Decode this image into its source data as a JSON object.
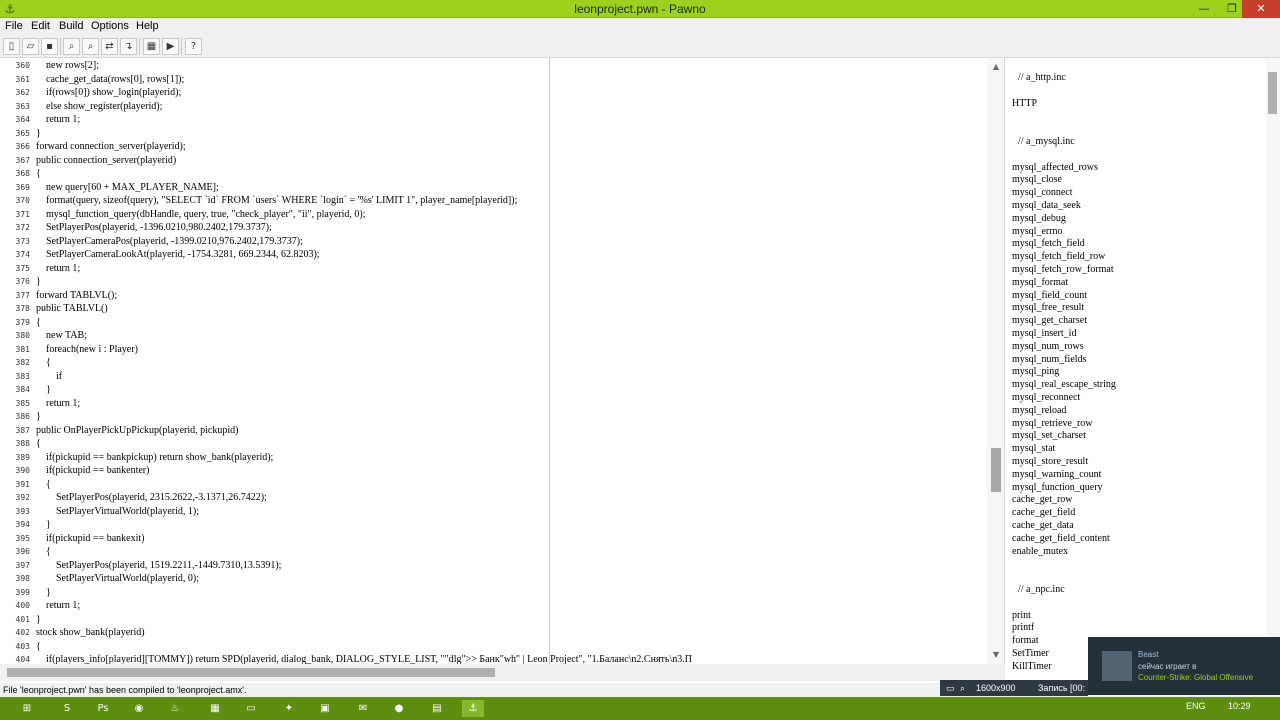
{
  "window": {
    "title": "leonproject.pwn - Pawno",
    "min": "—",
    "max": "❐",
    "close": "✕",
    "app_icon": "⚓"
  },
  "menu": [
    "File",
    "Edit",
    "Build",
    "Options",
    "Help"
  ],
  "toolbar": [
    {
      "name": "new-file-icon",
      "glyph": "▯"
    },
    {
      "name": "open-file-icon",
      "glyph": "▱"
    },
    {
      "name": "save-icon",
      "glyph": "▪"
    },
    {
      "name": "find-icon",
      "glyph": "⌕"
    },
    {
      "name": "find-next-icon",
      "glyph": "⌕"
    },
    {
      "name": "replace-icon",
      "glyph": "⇄"
    },
    {
      "name": "goto-icon",
      "glyph": "↴"
    },
    {
      "name": "compile-icon",
      "glyph": "▦"
    },
    {
      "name": "run-icon",
      "glyph": "▶"
    },
    {
      "name": "help-icon",
      "glyph": "?"
    }
  ],
  "editor": {
    "line_numbers": [
      "360",
      "361",
      "362",
      "363",
      "364",
      "365",
      "366",
      "367",
      "368",
      "369",
      "370",
      "371",
      "372",
      "373",
      "374",
      "375",
      "376",
      "377",
      "378",
      "379",
      "380",
      "381",
      "382",
      "383",
      "384",
      "385",
      "386",
      "387",
      "388",
      "389",
      "390",
      "391",
      "392",
      "393",
      "394",
      "395",
      "396",
      "397",
      "398",
      "399",
      "400",
      "401",
      "402",
      "403",
      "404"
    ],
    "lines": [
      "\tnew rows[2];",
      "\tcache_get_data(rows[0], rows[1]);",
      "\tif(rows[0]) show_login(playerid);",
      "\telse show_register(playerid);",
      "\treturn 1;",
      "}",
      "forward connection_server(playerid);",
      "public connection_server(playerid)",
      "{",
      "\tnew query[60 + MAX_PLAYER_NAME];",
      "\tformat(query, sizeof(query), \"SELECT `id` FROM `users` WHERE `login` = '%s' LIMIT 1\", player_name[playerid]);",
      "\tmysql_function_query(dbHandle, query, true, \"check_player\", \"ii\", playerid, 0);",
      "\tSetPlayerPos(playerid, -1396.0210,980.2402,179.3737);",
      "\tSetPlayerCameraPos(playerid, -1399.0210,976.2402,179.3737);",
      "\tSetPlayerCameraLookAt(playerid, -1754.3281, 669.2344, 62.8203);",
      "\treturn 1;",
      "}",
      "forward TABLVL();",
      "public TABLVL()",
      "{",
      "\tnew TAB;",
      "\tforeach(new i : Player)",
      "\t{",
      "\t\tif",
      "\t}",
      "\treturn 1;",
      "}",
      "public OnPlayerPickUpPickup(playerid, pickupid)",
      "{",
      "\tif(pickupid == bankpickup) return show_bank(playerid);",
      "\tif(pickupid == bankenter)",
      "\t{",
      "\t\tSetPlayerPos(playerid, 2315.2622,-3.1371,26.7422);",
      "\t\tSetPlayerVirtualWorld(playerid, 1);",
      "\t}",
      "\tif(pickupid == bankexit)",
      "\t{",
      "\t\tSetPlayerPos(playerid, 1519.2211,-1449.7310,13.5391);",
      "\t\tSetPlayerVirtualWorld(playerid, 0);",
      "\t}",
      "\treturn 1;",
      "}",
      "stock show_bank(playerid)",
      "{",
      "\tif(players_info[playerid][TOMMY]) return SPD(playerid, dialog_bank, DIALOG_STYLE_LIST, \"\"dlg\">> Банк\"wh\" | Leon Project\", \"1.Баланс\\n2.Снять\\n3.П"
    ]
  },
  "side": [
    "// a_http.inc",
    "",
    "HTTP",
    "",
    "",
    "// a_mysql.inc",
    "",
    "mysql_affected_rows",
    "mysql_close",
    "mysql_connect",
    "mysql_data_seek",
    "mysql_debug",
    "mysql_errno",
    "mysql_fetch_field",
    "mysql_fetch_field_row",
    "mysql_fetch_row_format",
    "mysql_format",
    "mysql_field_count",
    "mysql_free_result",
    "mysql_get_charset",
    "mysql_insert_id",
    "mysql_num_rows",
    "mysql_num_fields",
    "mysql_ping",
    "mysql_real_escape_string",
    "mysql_reconnect",
    "mysql_reload",
    "mysql_retrieve_row",
    "mysql_set_charset",
    "mysql_stat",
    "mysql_store_result",
    "mysql_warning_count",
    "mysql_function_query",
    "cache_get_row",
    "cache_get_field",
    "cache_get_data",
    "cache_get_field_content",
    "enable_mutex",
    "",
    "",
    "// a_npc.inc",
    "",
    "print",
    "printf",
    "format",
    "SetTimer",
    "KillTimer"
  ],
  "status": "File 'leonproject.pwn' has been compiled to 'leonproject.amx'.",
  "recording": {
    "resolution": "1600x900",
    "label": "Запись [00:"
  },
  "notification": {
    "user": "Beast",
    "line2": "сейчас играет в",
    "game": "Counter-Strike: Global Offensive"
  },
  "taskbar": {
    "items": [
      "⊞",
      "S",
      "Ps",
      "◉",
      "♨",
      "▦",
      "▭",
      "✦",
      "▣",
      "✉",
      "●",
      "▤",
      "⚓"
    ],
    "lang": "ENG",
    "time": "10:29"
  }
}
